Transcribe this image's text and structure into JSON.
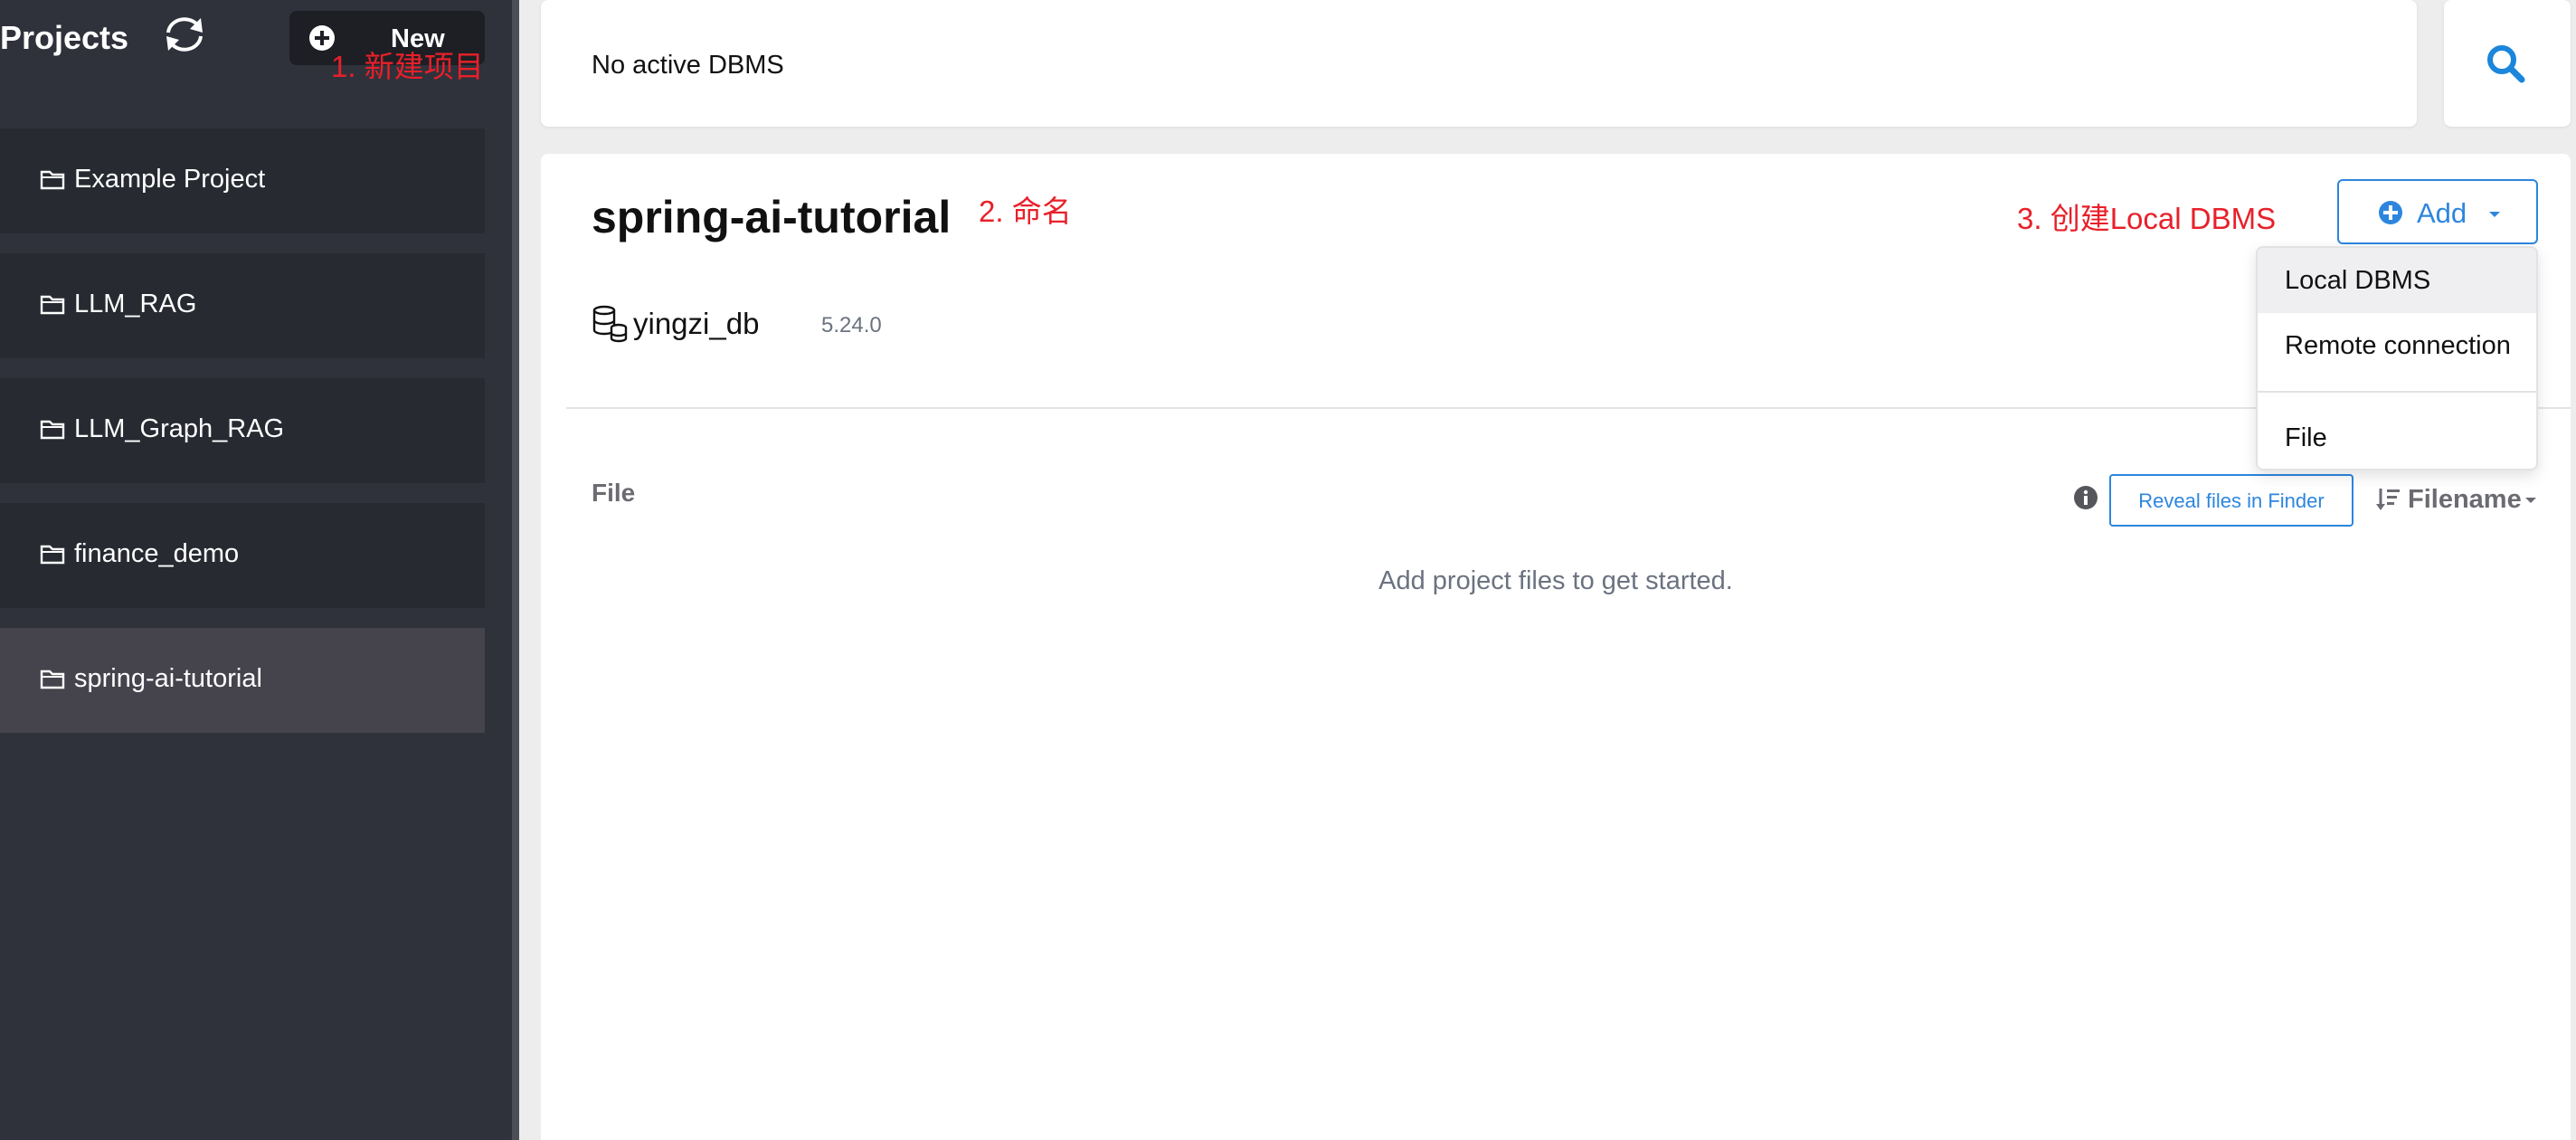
{
  "sidebar": {
    "title": "Projects",
    "refresh_icon": "refresh-icon",
    "new_button": {
      "icon": "plus-circle-icon",
      "label": "New"
    },
    "projects": [
      {
        "name": "Example Project",
        "active": false
      },
      {
        "name": "LLM_RAG",
        "active": false
      },
      {
        "name": "LLM_Graph_RAG",
        "active": false
      },
      {
        "name": "finance_demo",
        "active": false
      },
      {
        "name": "spring-ai-tutorial",
        "active": true
      }
    ]
  },
  "annotations": {
    "step1": "1. 新建项目",
    "step2": "2. 命名",
    "step3": "3. 创建Local DBMS",
    "color": "#e8202a"
  },
  "topbar": {
    "status": "No active DBMS",
    "search_icon": "search-icon"
  },
  "project": {
    "title": "spring-ai-tutorial",
    "add_button": {
      "label": "Add",
      "icon": "plus-circle-icon"
    },
    "dbms": [
      {
        "name": "yingzi_db",
        "version": "5.24.0",
        "icon": "database-icon"
      }
    ],
    "add_menu": {
      "items": [
        "Local DBMS",
        "Remote connection",
        "File"
      ],
      "highlighted": "Local DBMS"
    },
    "files": {
      "heading": "File",
      "reveal_button": "Reveal files in Finder",
      "sort_label": "Filename",
      "empty_message": "Add project files to get started."
    }
  },
  "colors": {
    "sidebar_bg": "#2f323b",
    "accent": "#2d86de",
    "annotation": "#e8202a"
  }
}
